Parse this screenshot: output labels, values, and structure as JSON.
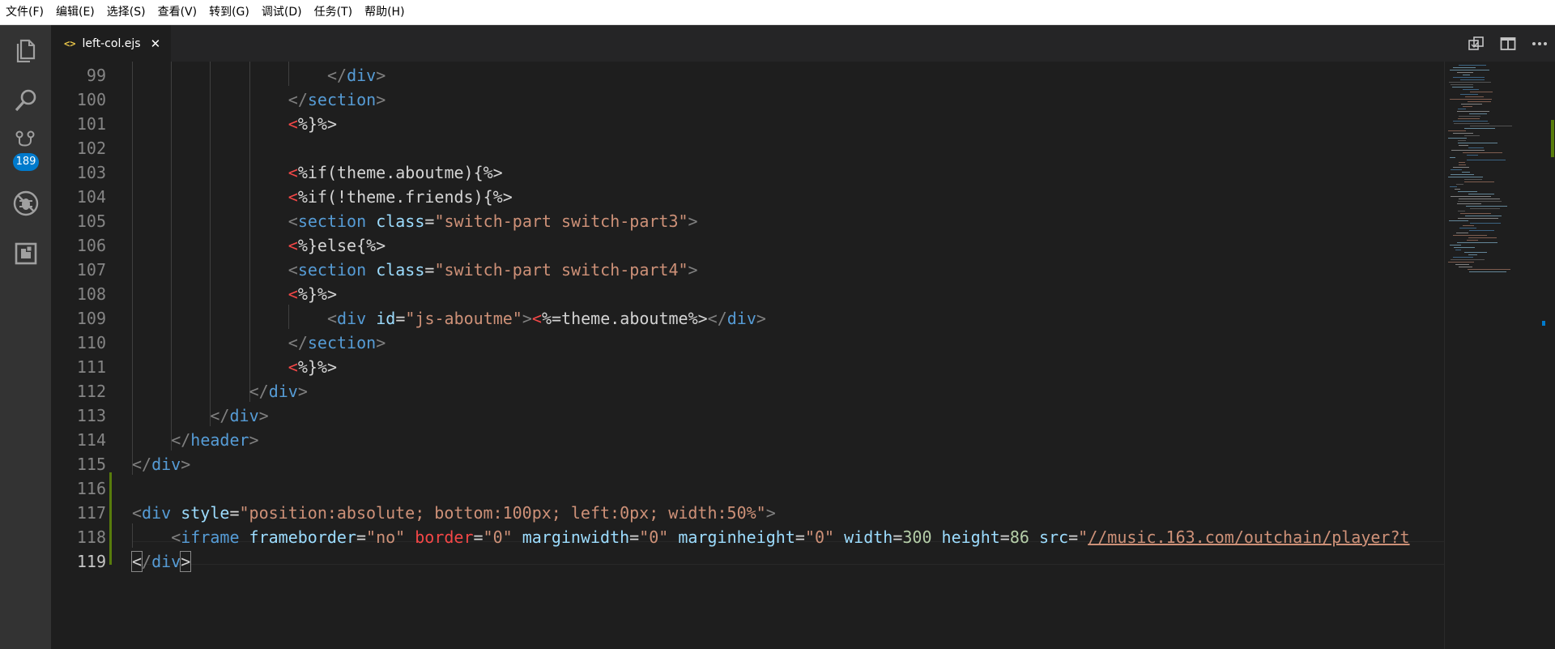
{
  "menubar": {
    "items": [
      "文件(F)",
      "编辑(E)",
      "选择(S)",
      "查看(V)",
      "转到(G)",
      "调试(D)",
      "任务(T)",
      "帮助(H)"
    ]
  },
  "activitybar": {
    "icons": [
      "files-icon",
      "search-icon",
      "source-control-icon",
      "debug-icon",
      "extensions-icon"
    ],
    "source_control_badge": "189"
  },
  "tab": {
    "icon": "<>",
    "filename": "left-col.ejs",
    "close": "✕"
  },
  "colors": {
    "accent": "#007acc",
    "git_modified": "#587c0c",
    "tag": "#569cd6",
    "attribute": "#9cdcfe",
    "string": "#ce9178"
  },
  "editor": {
    "line_numbers": [
      "99",
      "100",
      "101",
      "102",
      "103",
      "104",
      "105",
      "106",
      "107",
      "108",
      "109",
      "110",
      "111",
      "112",
      "113",
      "114",
      "115",
      "116",
      "117",
      "118",
      "119"
    ],
    "active_line": "119",
    "lines": [
      [
        {
          "c": "b",
          "t": "</"
        },
        {
          "c": "t",
          "t": "div"
        },
        {
          "c": "b",
          "t": ">"
        }
      ],
      [
        {
          "c": "b",
          "t": "</"
        },
        {
          "c": "t",
          "t": "section"
        },
        {
          "c": "b",
          "t": ">"
        }
      ],
      [
        {
          "c": "r",
          "t": "<"
        },
        {
          "c": "x",
          "t": "%}%>"
        }
      ],
      [],
      [
        {
          "c": "r",
          "t": "<"
        },
        {
          "c": "x",
          "t": "%if(theme.aboutme){%>"
        }
      ],
      [
        {
          "c": "r",
          "t": "<"
        },
        {
          "c": "x",
          "t": "%if(!theme.friends){%>"
        }
      ],
      [
        {
          "c": "b",
          "t": "<"
        },
        {
          "c": "t",
          "t": "section"
        },
        {
          "c": "x",
          "t": " "
        },
        {
          "c": "a",
          "t": "class"
        },
        {
          "c": "x",
          "t": "="
        },
        {
          "c": "s",
          "t": "\"switch-part switch-part3\""
        },
        {
          "c": "b",
          "t": ">"
        }
      ],
      [
        {
          "c": "r",
          "t": "<"
        },
        {
          "c": "x",
          "t": "%}else{%>"
        }
      ],
      [
        {
          "c": "b",
          "t": "<"
        },
        {
          "c": "t",
          "t": "section"
        },
        {
          "c": "x",
          "t": " "
        },
        {
          "c": "a",
          "t": "class"
        },
        {
          "c": "x",
          "t": "="
        },
        {
          "c": "s",
          "t": "\"switch-part switch-part4\""
        },
        {
          "c": "b",
          "t": ">"
        }
      ],
      [
        {
          "c": "r",
          "t": "<"
        },
        {
          "c": "x",
          "t": "%}%>"
        }
      ],
      [
        {
          "c": "b",
          "t": "<"
        },
        {
          "c": "t",
          "t": "div"
        },
        {
          "c": "x",
          "t": " "
        },
        {
          "c": "a",
          "t": "id"
        },
        {
          "c": "x",
          "t": "="
        },
        {
          "c": "s",
          "t": "\"js-aboutme\""
        },
        {
          "c": "b",
          "t": ">"
        },
        {
          "c": "r",
          "t": "<"
        },
        {
          "c": "x",
          "t": "%=theme.aboutme%>"
        },
        {
          "c": "b",
          "t": "</"
        },
        {
          "c": "t",
          "t": "div"
        },
        {
          "c": "b",
          "t": ">"
        }
      ],
      [
        {
          "c": "b",
          "t": "</"
        },
        {
          "c": "t",
          "t": "section"
        },
        {
          "c": "b",
          "t": ">"
        }
      ],
      [
        {
          "c": "r",
          "t": "<"
        },
        {
          "c": "x",
          "t": "%}%>"
        }
      ],
      [
        {
          "c": "b",
          "t": "</"
        },
        {
          "c": "t",
          "t": "div"
        },
        {
          "c": "b",
          "t": ">"
        }
      ],
      [
        {
          "c": "b",
          "t": "</"
        },
        {
          "c": "t",
          "t": "div"
        },
        {
          "c": "b",
          "t": ">"
        }
      ],
      [
        {
          "c": "b",
          "t": "</"
        },
        {
          "c": "t",
          "t": "header"
        },
        {
          "c": "b",
          "t": ">"
        }
      ],
      [
        {
          "c": "b",
          "t": "</"
        },
        {
          "c": "t",
          "t": "div"
        },
        {
          "c": "b",
          "t": ">"
        }
      ],
      [],
      [
        {
          "c": "b",
          "t": "<"
        },
        {
          "c": "t",
          "t": "div"
        },
        {
          "c": "x",
          "t": " "
        },
        {
          "c": "a",
          "t": "style"
        },
        {
          "c": "x",
          "t": "="
        },
        {
          "c": "s",
          "t": "\"position:absolute; bottom:100px; left:0px; width:50%\""
        },
        {
          "c": "b",
          "t": ">"
        }
      ],
      [
        {
          "c": "b",
          "t": "<"
        },
        {
          "c": "t",
          "t": "iframe"
        },
        {
          "c": "x",
          "t": " "
        },
        {
          "c": "a",
          "t": "frameborder"
        },
        {
          "c": "x",
          "t": "="
        },
        {
          "c": "s",
          "t": "\"no\""
        },
        {
          "c": "x",
          "t": " "
        },
        {
          "c": "r",
          "t": "border"
        },
        {
          "c": "x",
          "t": "="
        },
        {
          "c": "s",
          "t": "\"0\""
        },
        {
          "c": "x",
          "t": " "
        },
        {
          "c": "a",
          "t": "marginwidth"
        },
        {
          "c": "x",
          "t": "="
        },
        {
          "c": "s",
          "t": "\"0\""
        },
        {
          "c": "x",
          "t": " "
        },
        {
          "c": "a",
          "t": "marginheight"
        },
        {
          "c": "x",
          "t": "="
        },
        {
          "c": "s",
          "t": "\"0\""
        },
        {
          "c": "x",
          "t": " "
        },
        {
          "c": "a",
          "t": "width"
        },
        {
          "c": "x",
          "t": "="
        },
        {
          "c": "n",
          "t": "300"
        },
        {
          "c": "x",
          "t": " "
        },
        {
          "c": "a",
          "t": "height"
        },
        {
          "c": "x",
          "t": "="
        },
        {
          "c": "n",
          "t": "86"
        },
        {
          "c": "x",
          "t": " "
        },
        {
          "c": "a",
          "t": "src"
        },
        {
          "c": "x",
          "t": "="
        },
        {
          "c": "s",
          "t": "\""
        },
        {
          "c": "u",
          "t": "//music.163.com/outchain/player?t"
        }
      ],
      [
        {
          "c": "bm",
          "t": "<"
        },
        {
          "c": "b",
          "t": "/"
        },
        {
          "c": "t",
          "t": "div"
        },
        {
          "c": "bm",
          "t": ">"
        }
      ]
    ]
  }
}
